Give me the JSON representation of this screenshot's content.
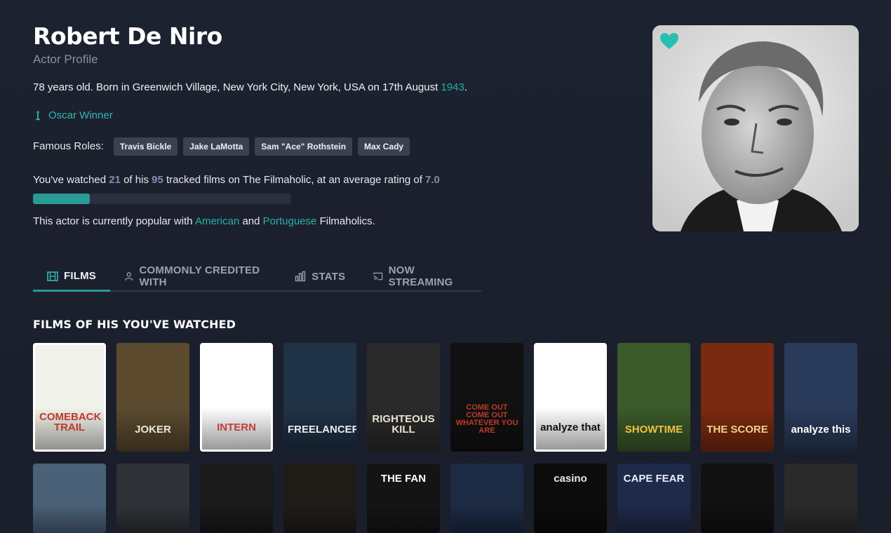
{
  "actor": {
    "name": "Robert De Niro",
    "subtitle": "Actor Profile",
    "bio_prefix": "78 years old. Born in Greenwich Village, New York City, New York, USA on 17th August ",
    "birth_year": "1943",
    "bio_suffix": ".",
    "award": "Oscar Winner",
    "roles_label": "Famous Roles:",
    "roles": [
      "Travis Bickle",
      "Jake LaMotta",
      "Sam \"Ace\" Rothstein",
      "Max Cady"
    ],
    "watched": {
      "p1": "You've watched ",
      "watched_count": "21",
      "p2": " of his ",
      "tracked_count": "95",
      "p3": " tracked films on The Filmaholic, at an average rating of ",
      "avg_rating": "7.0",
      "progress_fraction": 0.221
    },
    "popular": {
      "p1": "This actor is currently popular with ",
      "c1": "American",
      "p2": " and ",
      "c2": "Portuguese",
      "p3": " Filmaholics."
    }
  },
  "tabs": [
    {
      "label": "FILMS",
      "icon": "film-icon",
      "active": true
    },
    {
      "label": "COMMONLY CREDITED WITH",
      "icon": "people-icon",
      "active": false
    },
    {
      "label": "STATS",
      "icon": "bar-chart-icon",
      "active": false
    },
    {
      "label": "NOW STREAMING",
      "icon": "cast-icon",
      "active": false
    }
  ],
  "section_title": "FILMS OF HIS YOU'VE WATCHED",
  "posters_row1": [
    {
      "text": "COMEBACK TRAIL",
      "bg": "#f2f2ec",
      "fg": "#c0392b"
    },
    {
      "text": "JOKER",
      "bg": "#5b4a2e",
      "fg": "#efe6d2"
    },
    {
      "text": "INTERN",
      "bg": "#ffffff",
      "fg": "#c23b3b"
    },
    {
      "text": "FREELANCERS",
      "bg": "#203246",
      "fg": "#e8edf2"
    },
    {
      "text": "RIGHTEOUS KILL",
      "bg": "#2a2a2a",
      "fg": "#e9e2d0"
    },
    {
      "text": "COME OUT COME OUT WHATEVER YOU ARE",
      "bg": "#111111",
      "fg": "#c0392b"
    },
    {
      "text": "analyze that",
      "bg": "#ffffff",
      "fg": "#111111"
    },
    {
      "text": "SHOWTIME",
      "bg": "#3b5a2a",
      "fg": "#f0c040"
    },
    {
      "text": "THE SCORE",
      "bg": "#7a2a10",
      "fg": "#f1d08a"
    },
    {
      "text": "analyze this",
      "bg": "#2a3a5a",
      "fg": "#ffffff"
    }
  ],
  "posters_row2": [
    {
      "text": "",
      "bg": "#4a6178",
      "fg": "#ffffff"
    },
    {
      "text": "",
      "bg": "#2f3338",
      "fg": "#ffffff"
    },
    {
      "text": "",
      "bg": "#1a1a1a",
      "fg": "#ffffff"
    },
    {
      "text": "",
      "bg": "#1f1c18",
      "fg": "#e0d8c0"
    },
    {
      "text": "THE FAN",
      "bg": "#141414",
      "fg": "#ffffff"
    },
    {
      "text": "",
      "bg": "#1c2a44",
      "fg": "#ffffff"
    },
    {
      "text": "casino",
      "bg": "#0c0c0c",
      "fg": "#e9e9e9"
    },
    {
      "text": "CAPE FEAR",
      "bg": "#1e2a4a",
      "fg": "#e8edf6"
    },
    {
      "text": "",
      "bg": "#111111",
      "fg": "#ffffff"
    },
    {
      "text": "",
      "bg": "#2a2a2a",
      "fg": "#ffffff"
    }
  ],
  "colors": {
    "accent": "#27b2a5",
    "progress_fill": "#2a9a94",
    "heart": "#27c0b0"
  }
}
